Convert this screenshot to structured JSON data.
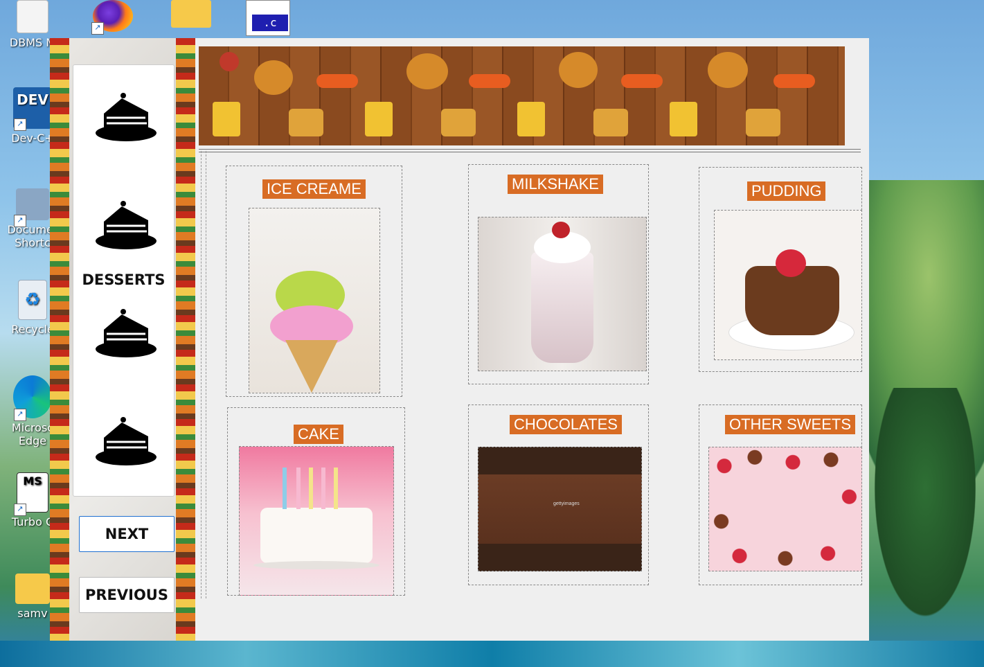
{
  "desktop": {
    "icons": [
      {
        "label": "DBMS M",
        "icon": "document-icon"
      },
      {
        "label": "Dev-C+",
        "icon": "devcpp-icon"
      },
      {
        "label": "Documer",
        "label2": "Shortc",
        "icon": "documents-shortcut-icon"
      },
      {
        "label": "Recycle",
        "icon": "recycle-bin-icon"
      },
      {
        "label": "Microsc",
        "label2": "Edge",
        "icon": "edge-icon"
      },
      {
        "label": "Turbo C",
        "icon": "turbo-c-icon"
      },
      {
        "label": "samv",
        "icon": "folder-icon"
      }
    ],
    "top_icons": [
      "firefox-icon",
      "folder-icon",
      "c-file-icon"
    ],
    "c_file_ext": ".c",
    "turbo_badge": "MS"
  },
  "sidebar": {
    "category_title": "DESSERTS",
    "next_label": "NEXT",
    "previous_label": "PREVIOUS"
  },
  "menu": {
    "items": [
      {
        "label": "ICE CREAME"
      },
      {
        "label": "MILKSHAKE"
      },
      {
        "label": "PUDDING"
      },
      {
        "label": "CAKE"
      },
      {
        "label": "CHOCOLATES"
      },
      {
        "label": "OTHER SWEETS"
      }
    ],
    "watermark": "gettyimages"
  },
  "colors": {
    "label_bg": "#d86c24",
    "label_text": "#ffffff",
    "window_bg": "#efefef"
  }
}
